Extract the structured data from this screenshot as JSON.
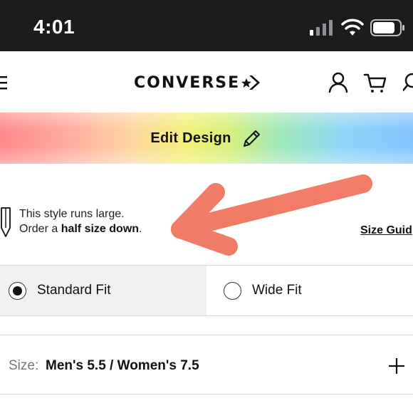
{
  "status_bar": {
    "time": "4:01",
    "icons": [
      "signal-icon",
      "wifi-icon",
      "battery-icon"
    ]
  },
  "header": {
    "brand": "CONVERSE",
    "icons": [
      "menu-icon",
      "star-chevron-logo-icon",
      "account-icon",
      "cart-icon",
      "search-icon"
    ]
  },
  "banner": {
    "label": "Edit Design",
    "icon": "pencil-icon"
  },
  "fit_note": {
    "line1": "This style runs large.",
    "line2_prefix": "Order a ",
    "line2_bold": "half size down",
    "line2_suffix": ".",
    "size_guide": "Size Guid",
    "icon": "ruler-icon"
  },
  "annotation": {
    "type": "arrow",
    "color": "#f06a52"
  },
  "fit_options": [
    {
      "label": "Standard Fit",
      "selected": true
    },
    {
      "label": "Wide Fit",
      "selected": false
    }
  ],
  "size": {
    "prefix": "Size:",
    "value": "Men's 5.5 / Women's 7.5",
    "expand_icon": "plus-icon"
  },
  "colors": {
    "status_bar_bg": "#1c1c1e",
    "selected_fit_bg": "#f1f1f1",
    "annotation": "#f06a52"
  }
}
